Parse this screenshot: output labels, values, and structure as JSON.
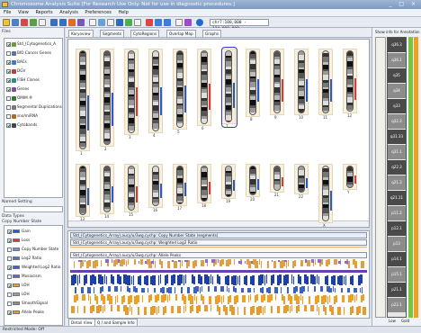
{
  "window": {
    "title": "Chromosome Analysis Suite  [For Research Use Only. Not for use in diagnostic procedures.]",
    "controls": "_ □ ×"
  },
  "menu": [
    "File",
    "View",
    "Reports",
    "Analysis",
    "Preferences",
    "Help"
  ],
  "toolbar": {
    "coordinate": "chr7:100,000 - 124,000,000"
  },
  "left_panel": {
    "files_header": "Files",
    "files": [
      {
        "label": "Std_(Cytogenetics_A",
        "checked": true,
        "color": "#6a9d3a"
      },
      {
        "label": "BIO Cancer Genes",
        "checked": false,
        "color": "#5b6fb5"
      },
      {
        "label": "BACs",
        "checked": true,
        "color": "#3f7ad1"
      },
      {
        "label": "DGV",
        "checked": true,
        "color": "#c23a3a"
      },
      {
        "label": "FISH Clones",
        "checked": true,
        "color": "#2f8a8a"
      },
      {
        "label": "Genes",
        "checked": true,
        "color": "#7d4bb3"
      },
      {
        "label": "OMIM ®",
        "checked": false,
        "color": "#2e7d32"
      },
      {
        "label": "Segmental Duplications",
        "checked": false,
        "color": "#777777"
      },
      {
        "label": "sno/miRNA",
        "checked": false,
        "color": "#b36b1f"
      },
      {
        "label": "Cytobands",
        "checked": true,
        "color": "#444444"
      }
    ],
    "named_setting_label": "Named Setting",
    "data_types_header": "Data Types",
    "data_types_subheader": "Copy Number State",
    "data_types": [
      {
        "label": "Gain",
        "checked": true,
        "color": "#2a58c9"
      },
      {
        "label": "Loss",
        "checked": true,
        "color": "#d43a3a"
      },
      {
        "label": "Copy Number State",
        "checked": false,
        "color": "#7a8ed8"
      },
      {
        "label": "Log2 Ratio",
        "checked": false,
        "color": "#4a75d4"
      },
      {
        "label": "Weighted Log2 Ratio",
        "checked": true,
        "color": "#3a5fc7"
      },
      {
        "label": "Mosaicism",
        "checked": false,
        "color": "#7e57c2"
      },
      {
        "label": "LOH",
        "checked": true,
        "color": "#f0a020"
      },
      {
        "label": "LOH",
        "checked": false,
        "color": "#9e9e9e"
      },
      {
        "label": "SmoothSignal",
        "checked": false,
        "color": "#8a8a8a"
      },
      {
        "label": "Allele Peaks",
        "checked": true,
        "color": "#e89b2c"
      }
    ]
  },
  "main": {
    "tabs": [
      "Karyoview",
      "Segments",
      "CytoRegions",
      "Overlap Map",
      "Graphs"
    ],
    "active_tab": 0,
    "chromosome_row1": [
      "1",
      "2",
      "3",
      "4",
      "5",
      "6",
      "7",
      "8",
      "9",
      "10",
      "11",
      "12"
    ],
    "chromosome_row2": [
      "13",
      "14",
      "15",
      "16",
      "17",
      "18",
      "19",
      "20",
      "21",
      "22",
      "X",
      "Y"
    ],
    "track_headers": [
      "Std_(Cytogenetics_Array).aucy/u/3wg.cychp: Copy Number State (segments)",
      "Std_(Cytogenetics_Array).aucy/u/3wg.cychp: Weighted Log2 Ratio",
      "Std_(Cytogenetics_Array).aucy/u/3wg.cychp: Allele Peaks"
    ],
    "bottom_tabs": [
      "Detail View",
      "Q / and Sample Info"
    ]
  },
  "right_panel": {
    "header": "Show info for Annotation",
    "bands": [
      "q36.3",
      "q36.1",
      "q35",
      "q34",
      "q33",
      "q32.3",
      "q31.33",
      "q31.1",
      "q22.3",
      "q21.3",
      "q21.11",
      "p11.2",
      "p12.1",
      "p13",
      "p14.1",
      "p15.1",
      "p21.1",
      "p22.1"
    ],
    "footer": [
      "Low",
      "Gold"
    ]
  },
  "status": {
    "text": "Restricted Mode: Off"
  },
  "colors": {
    "gain": "#2a58c9",
    "loss": "#d43a3a",
    "loh": "#f0a020",
    "accent_green": "#7cc242"
  }
}
